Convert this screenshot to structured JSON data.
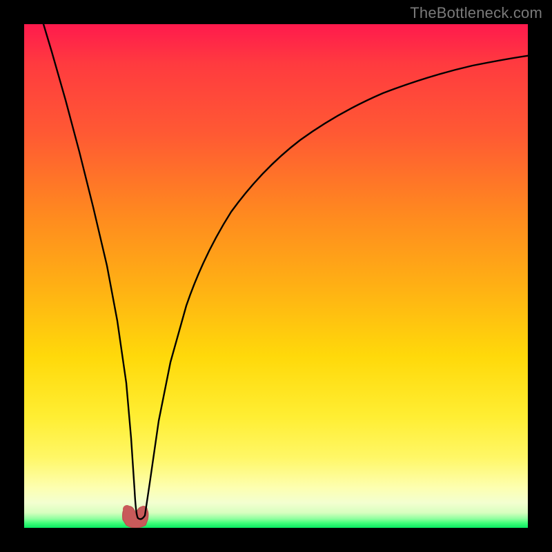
{
  "watermark": "TheBottleneck.com",
  "chart_data": {
    "type": "line",
    "title": "",
    "xlabel": "",
    "ylabel": "",
    "xlim": [
      0,
      100
    ],
    "ylim": [
      0,
      100
    ],
    "grid": false,
    "legend": false,
    "background_gradient": {
      "direction": "vertical",
      "stops": [
        {
          "pos": 0.0,
          "color": "#ff1a4d"
        },
        {
          "pos": 0.3,
          "color": "#ff7a26"
        },
        {
          "pos": 0.6,
          "color": "#ffd90a"
        },
        {
          "pos": 0.88,
          "color": "#fff766"
        },
        {
          "pos": 0.97,
          "color": "#b8ffb0"
        },
        {
          "pos": 1.0,
          "color": "#08e860"
        }
      ]
    },
    "series": [
      {
        "name": "bottleneck-curve",
        "color": "#000000",
        "x": [
          0,
          2,
          4,
          6,
          8,
          10,
          12,
          14,
          16,
          18,
          20,
          21,
          22,
          24,
          26,
          28,
          30,
          33,
          36,
          40,
          45,
          50,
          55,
          60,
          65,
          70,
          75,
          80,
          85,
          90,
          95,
          100
        ],
        "y": [
          100,
          92,
          84,
          76,
          68,
          59,
          50,
          41,
          31,
          20,
          8,
          3,
          2,
          8,
          18,
          28,
          36,
          46,
          54,
          62,
          70,
          76,
          80.5,
          84,
          86.7,
          88.8,
          90.4,
          91.6,
          92.5,
          93.2,
          93.7,
          94.1
        ]
      }
    ],
    "markers": [
      {
        "name": "min-region",
        "shape": "round-blob",
        "color": "#c85a5a",
        "x_range": [
          19.5,
          23.5
        ],
        "y_range": [
          0,
          4
        ]
      }
    ],
    "minimum": {
      "x": 21.5,
      "y": 1.5
    }
  }
}
